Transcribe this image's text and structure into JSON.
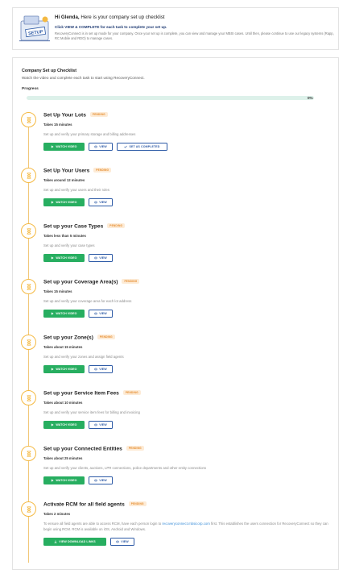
{
  "header": {
    "greeting_name": "Hi Glenda,",
    "greeting_rest": " Here is your company set up checklist",
    "instruction": "Click VIEW & COMPLETE for each task to complete your set up.",
    "intro": "RecoveryConnect is in set up mode for your company. Once your set up is complete, you can view and manage your MBSI cases. Until then, please continue to use our legacy systems (Rapp, RC Mobile and RDO) to manage cases.",
    "illustration_label": "SETUP",
    "illustration_icon": "setup-folder-icon"
  },
  "checklist": {
    "title": "Company Set up Checklist",
    "subtitle": "Watch the video and complete each task to start using RecoveryConnect.",
    "progress_label": "Progress",
    "progress_value": 0,
    "progress_text": "0%",
    "colors": {
      "accent": "#27ae60",
      "brand": "#2d5aa6",
      "pending": "#e58b2c",
      "timeline": "#f4b942"
    },
    "steps": [
      {
        "title": "Set Up Your Lots",
        "badge": "PENDING",
        "duration": "Takes 15 minutes",
        "description": "Set up and verify your primary storage and billing addresses",
        "watch": "WATCH VIDEO",
        "view": "VIEW",
        "complete": "SET AS COMPLETED",
        "icon": "hourglass-icon"
      },
      {
        "title": "Set Up Your Users",
        "badge": "PENDING",
        "duration": "Takes around 12 minutes",
        "description": "Set up and verify your users and their roles",
        "watch": "WATCH VIDEO",
        "view": "VIEW",
        "icon": "hourglass-icon"
      },
      {
        "title": "Set up your Case Types",
        "badge": "PENDING",
        "duration": "Takes less than 5 minutes",
        "description": "Set up and verify your case types",
        "watch": "WATCH VIDEO",
        "view": "VIEW",
        "icon": "hourglass-icon"
      },
      {
        "title": "Set up your Coverage Area(s)",
        "badge": "PENDING",
        "duration": "Takes 15 minutes",
        "description": "Set up and verify your coverage area for each lot address",
        "watch": "WATCH VIDEO",
        "view": "VIEW",
        "icon": "hourglass-icon"
      },
      {
        "title": "Set up your Zone(s)",
        "badge": "PENDING",
        "duration": "Takes about 15 minutes",
        "description": "Set up and verify your zones and assign field agents",
        "watch": "WATCH VIDEO",
        "view": "VIEW",
        "icon": "hourglass-icon"
      },
      {
        "title": "Set up your Service Item Fees",
        "badge": "PENDING",
        "duration": "Takes about 10 minutes",
        "description": "Set up and verify your service item fees for billing and invoicing",
        "watch": "WATCH VIDEO",
        "view": "VIEW",
        "icon": "hourglass-icon"
      },
      {
        "title": "Set up your Connected Entities",
        "badge": "PENDING",
        "duration": "Takes about 25 minutes",
        "description": "Set up and verify your clients, auctions, LPR connections, police departments and other entity connections",
        "watch": "WATCH VIDEO",
        "view": "VIEW",
        "icon": "hourglass-icon"
      },
      {
        "title": "Activate RCM for all field agents",
        "badge": "PENDING",
        "duration": "Takes 2 minutes",
        "description_before": "To ensure all field agents are able to access RCM, have each person login to ",
        "description_link": "recoveryconnect.mbsicorp.com",
        "description_after": " first. This establishes the users connection for RecoveryConnect so they can begin using RCM. RCM is available on iOS, Android and Windows.",
        "download": "VIEW DOWNLOAD LINKS",
        "view": "VIEW",
        "icon": "hourglass-icon"
      }
    ]
  }
}
